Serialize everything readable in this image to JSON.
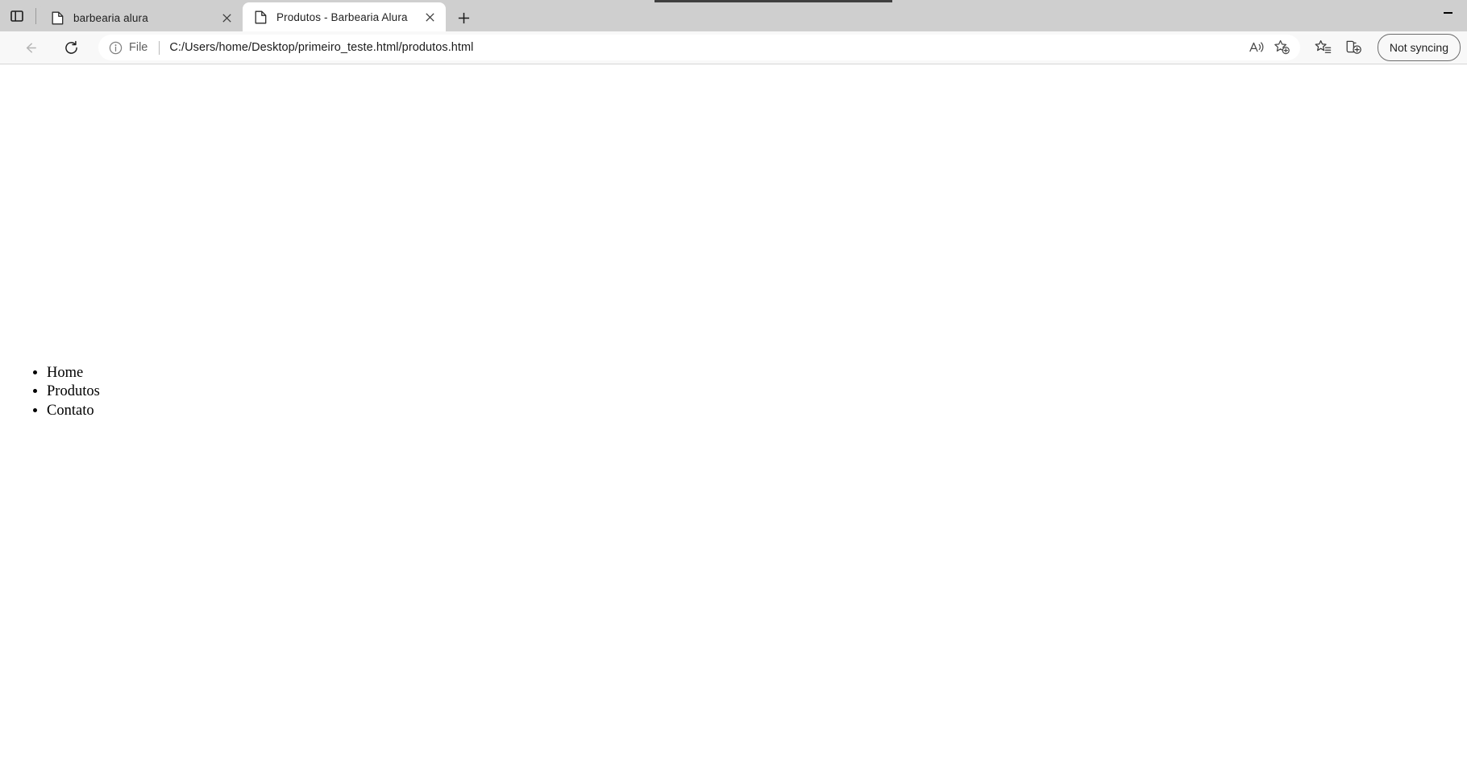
{
  "browser": {
    "tabstrip": {
      "tab_search_icon": "vertical-tabs-icon",
      "new_tab_label": "+",
      "tabs": [
        {
          "title": "barbearia alura",
          "favicon": "document-icon",
          "close_label": "✕",
          "active": false
        },
        {
          "title": "Produtos - Barbearia Alura",
          "favicon": "document-icon",
          "close_label": "✕",
          "active": true
        }
      ]
    },
    "window_controls": {
      "minimize_label": "–"
    },
    "toolbar": {
      "back_icon": "back-arrow-icon",
      "reload_icon": "reload-icon",
      "omnibox": {
        "info_icon": "info-circle-icon",
        "scheme_label": "File",
        "url": "C:/Users/home/Desktop/primeiro_teste.html/produtos.html",
        "read_aloud_icon": "read-aloud-icon",
        "add_favorite_icon": "add-favorite-star-icon"
      },
      "favorites_icon": "favorites-list-icon",
      "collections_icon": "collections-icon",
      "profile_label": "Not syncing"
    }
  },
  "page": {
    "title": "Produtos - Barbearia Alura",
    "nav_items": [
      {
        "label": "Home"
      },
      {
        "label": "Produtos"
      },
      {
        "label": "Contato"
      }
    ]
  },
  "colors": {
    "tabstrip_bg": "#cfcfcf",
    "toolbar_bg": "#f8f8f8",
    "active_tab_bg": "#ffffff",
    "page_bg": "#ffffff",
    "text": "#1f1f1f"
  }
}
